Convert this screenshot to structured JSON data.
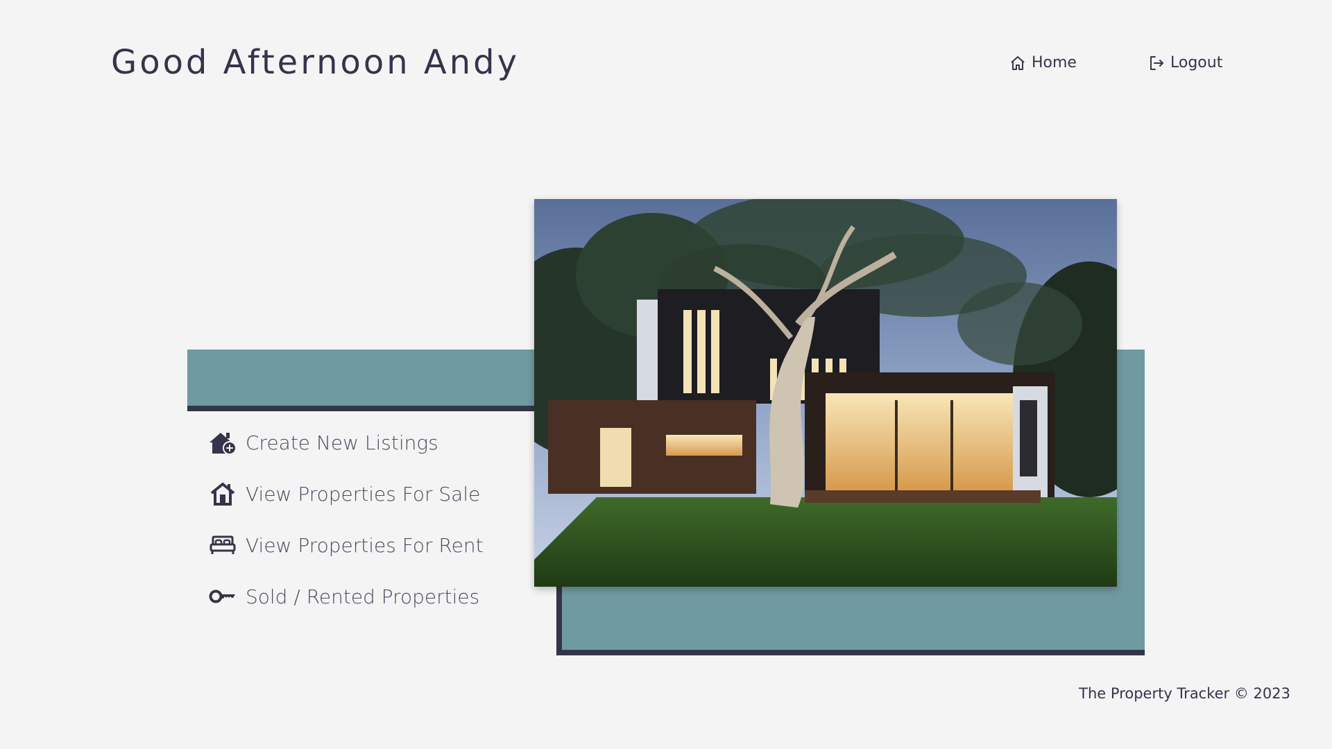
{
  "header": {
    "greeting": "Good Afternoon Andy"
  },
  "nav": {
    "home_label": "Home",
    "logout_label": "Logout"
  },
  "menu": {
    "items": [
      {
        "label": "Create New Listings",
        "icon": "house-plus-icon"
      },
      {
        "label": "View Properties For Sale",
        "icon": "house-icon"
      },
      {
        "label": "View Properties For Rent",
        "icon": "bed-icon"
      },
      {
        "label": "Sold / Rented Properties",
        "icon": "key-icon"
      }
    ]
  },
  "hero": {
    "image": "modern-house-photo"
  },
  "footer": {
    "text": "The Property Tracker © 2023"
  },
  "colors": {
    "background": "#f4f4f4",
    "accent_teal": "#6f9aa0",
    "dark": "#34344a"
  }
}
